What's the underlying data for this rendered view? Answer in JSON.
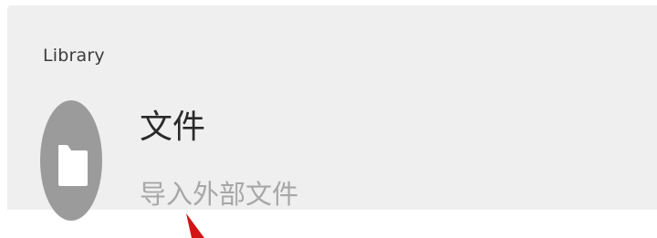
{
  "library": {
    "section_title": "Library",
    "items": [
      {
        "icon": "folder-icon",
        "title": "文件",
        "subtitle": "导入外部文件"
      }
    ]
  },
  "colors": {
    "panel_background": "#efefef",
    "icon_circle": "#9b9b9b",
    "title_text": "#2a2a2a",
    "subtitle_text": "#a7a7a7",
    "pointer": "#d21414"
  }
}
